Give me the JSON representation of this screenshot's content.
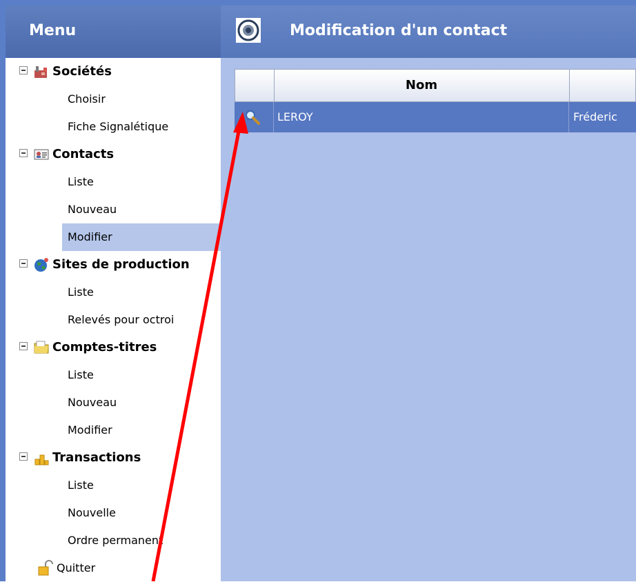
{
  "sidebar": {
    "header": "Menu",
    "groups": [
      {
        "label": "Sociétés",
        "icon": "factory-icon",
        "items": [
          "Choisir",
          "Fiche Signalétique"
        ]
      },
      {
        "label": "Contacts",
        "icon": "contact-card-icon",
        "items": [
          "Liste",
          "Nouveau",
          "Modifier"
        ]
      },
      {
        "label": "Sites de production",
        "icon": "globe-icon",
        "items": [
          "Liste",
          "Relevés pour octroi"
        ]
      },
      {
        "label": "Comptes-titres",
        "icon": "folder-icon",
        "items": [
          "Liste",
          "Nouveau",
          "Modifier"
        ]
      },
      {
        "label": "Transactions",
        "icon": "coins-icon",
        "items": [
          "Liste",
          "Nouvelle",
          "Ordre permanent"
        ]
      }
    ],
    "active_item": "Modifier",
    "quit_label": "Quitter"
  },
  "main": {
    "title": "Modification d'un contact",
    "grid": {
      "columns": [
        "",
        "Nom",
        ""
      ],
      "rows": [
        {
          "nom": "LEROY",
          "prenom": "Fréderic",
          "action_icon": "magnifier-icon"
        }
      ]
    }
  },
  "colors": {
    "header_blue": "#5677bb",
    "content_background": "#adc0e9",
    "selected_row": "#5677c2",
    "annotation_arrow": "#ff0000"
  }
}
